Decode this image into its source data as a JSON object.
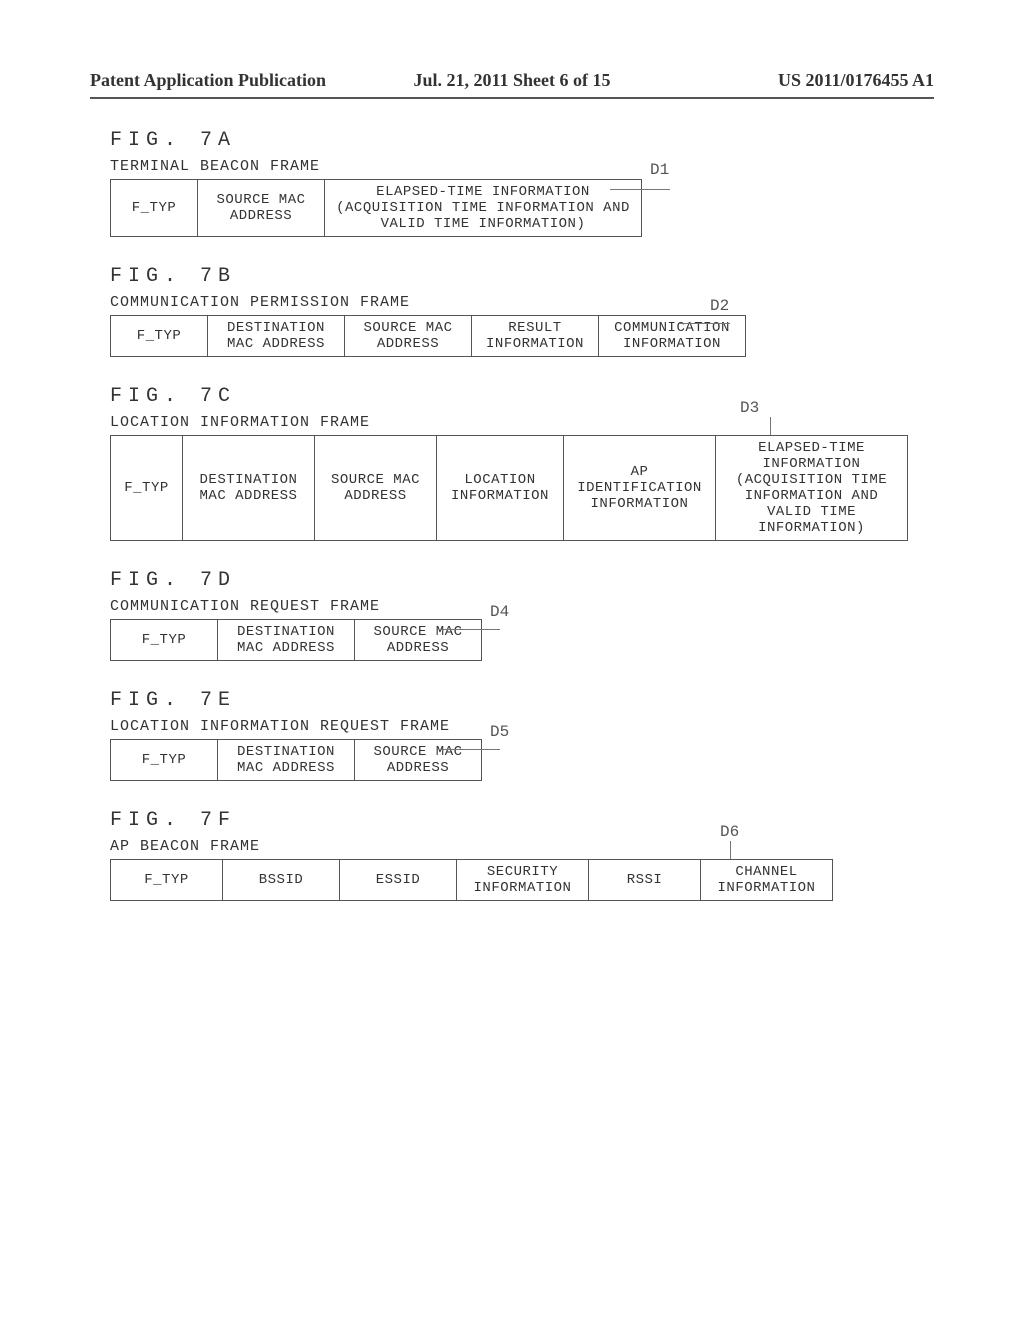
{
  "header": {
    "left": "Patent Application Publication",
    "mid": "Jul. 21, 2011  Sheet 6 of 15",
    "right": "US 2011/0176455 A1"
  },
  "figA": {
    "id": "FIG. 7A",
    "caption": "TERMINAL BEACON FRAME",
    "label": "D1",
    "cells": [
      "F_TYP",
      "SOURCE MAC ADDRESS",
      "ELAPSED-TIME INFORMATION (ACQUISITION TIME INFORMATION AND VALID TIME INFORMATION)"
    ]
  },
  "figB": {
    "id": "FIG. 7B",
    "caption": "COMMUNICATION PERMISSION FRAME",
    "label": "D2",
    "cells": [
      "F_TYP",
      "DESTINATION MAC ADDRESS",
      "SOURCE MAC ADDRESS",
      "RESULT INFORMATION",
      "COMMUNICATION INFORMATION"
    ]
  },
  "figC": {
    "id": "FIG. 7C",
    "caption": "LOCATION INFORMATION FRAME",
    "label": "D3",
    "cells": [
      "F_TYP",
      "DESTINATION MAC ADDRESS",
      "SOURCE MAC ADDRESS",
      "LOCATION INFORMATION",
      "AP IDENTIFICATION INFORMATION",
      "ELAPSED-TIME INFORMATION (ACQUISITION TIME INFORMATION AND VALID TIME INFORMATION)"
    ]
  },
  "figD": {
    "id": "FIG. 7D",
    "caption": "COMMUNICATION REQUEST FRAME",
    "label": "D4",
    "cells": [
      "F_TYP",
      "DESTINATION MAC ADDRESS",
      "SOURCE MAC ADDRESS"
    ]
  },
  "figE": {
    "id": "FIG. 7E",
    "caption": "LOCATION INFORMATION REQUEST FRAME",
    "label": "D5",
    "cells": [
      "F_TYP",
      "DESTINATION MAC ADDRESS",
      "SOURCE MAC ADDRESS"
    ]
  },
  "figF": {
    "id": "FIG. 7F",
    "caption": "AP BEACON FRAME",
    "label": "D6",
    "cells": [
      "F_TYP",
      "BSSID",
      "ESSID",
      "SECURITY INFORMATION",
      "RSSI",
      "CHANNEL INFORMATION"
    ]
  }
}
